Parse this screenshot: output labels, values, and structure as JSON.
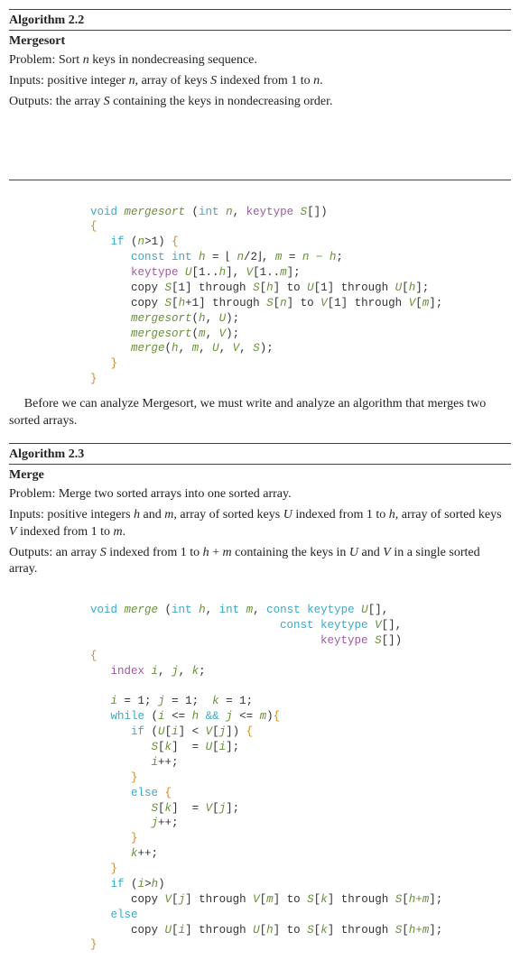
{
  "algo22": {
    "title": "Algorithm 2.2",
    "name": "Mergesort",
    "problem_label": "Problem: ",
    "problem": "Sort n keys in nondecreasing sequence.",
    "inputs_label": "Inputs: ",
    "inputs": "positive integer n, array of keys S indexed from 1 to n.",
    "outputs_label": "Outputs: ",
    "outputs": "the array S containing the keys in nondecreasing order.",
    "code": {
      "l1a": "void",
      "l1b": " mergesort ",
      "l1c": "(",
      "l1d": "int",
      "l1e": " n",
      "l1f": ", ",
      "l1g": "keytype",
      "l1h": " S",
      "l1i": "[])",
      "l2": "{",
      "l3a": "if",
      "l3b": " (",
      "l3c": "n",
      "l3d": ">1) ",
      "l3e": "{",
      "l4a": "const int",
      "l4b": " h ",
      "l4c": "= ⌊ ",
      "l4d": "n",
      "l4e": "/2⌋, ",
      "l4f": "m ",
      "l4g": "= ",
      "l4h": "n − h",
      "l4i": ";",
      "l5a": "keytype",
      "l5b": " U",
      "l5c": "[1..",
      "l5d": "h",
      "l5e": "], ",
      "l5f": "V",
      "l5g": "[1..",
      "l5h": "m",
      "l5i": "];",
      "l6a": "copy ",
      "l6b": "S",
      "l6c": "[1] through ",
      "l6d": "S",
      "l6e": "[",
      "l6f": "h",
      "l6g": "] to ",
      "l6h": "U",
      "l6i": "[1] through ",
      "l6j": "U",
      "l6k": "[",
      "l6l": "h",
      "l6m": "];",
      "l7a": "copy ",
      "l7b": "S",
      "l7c": "[",
      "l7d": "h",
      "l7e": "+1] through ",
      "l7f": "S",
      "l7g": "[",
      "l7h": "n",
      "l7i": "] to ",
      "l7j": "V",
      "l7k": "[1] through ",
      "l7l": "V",
      "l7m": "[",
      "l7n": "m",
      "l7o": "];",
      "l8a": "mergesort",
      "l8b": "(",
      "l8c": "h",
      "l8d": ", ",
      "l8e": "U",
      "l8f": ");",
      "l9a": "mergesort",
      "l9b": "(",
      "l9c": "m",
      "l9d": ", ",
      "l9e": "V",
      "l9f": ");",
      "l10a": "merge",
      "l10b": "(",
      "l10c": "h",
      "l10d": ", ",
      "l10e": "m",
      "l10f": ", ",
      "l10g": "U",
      "l10h": ", ",
      "l10i": "V",
      "l10j": ", ",
      "l10k": "S",
      "l10l": ");",
      "l11": "}",
      "l12": "}"
    }
  },
  "mid_para": "Before we can analyze Mergesort, we must write and analyze an algorithm that merges two sorted arrays.",
  "algo23": {
    "title": "Algorithm 2.3",
    "name": "Merge",
    "problem_label": "Problem: ",
    "problem": "Merge two sorted arrays into one sorted array.",
    "inputs_label": "Inputs: ",
    "inputs": "positive integers h and m, array of sorted keys U indexed from 1 to h, array of sorted keys V indexed from 1 to m.",
    "outputs_label": "Outputs: ",
    "outputs": "an array S indexed from 1 to h + m containing the keys in U and V in a single sorted array.",
    "code": {
      "l1a": "void",
      "l1b": " merge ",
      "l1c": "(",
      "l1d": "int",
      "l1e": " h",
      "l1f": ", ",
      "l1g": "int",
      "l1h": " m",
      "l1i": ", ",
      "l1j": "const keytype",
      "l1k": " U",
      "l1l": "[],",
      "l1m": "const keytype",
      "l1n": " V",
      "l1o": "[],",
      "l1p": "keytype",
      "l1q": " S",
      "l1r": "[])",
      "l2": "{",
      "l3a": "index",
      "l3b": " i",
      "l3c": ", ",
      "l3d": "j",
      "l3e": ", ",
      "l3f": "k",
      "l3g": ";",
      "l4a": "i ",
      "l4b": "= 1; ",
      "l4c": "j ",
      "l4d": "= 1;  ",
      "l4e": "k ",
      "l4f": "= 1;",
      "l5a": "while",
      "l5b": " (",
      "l5c": "i ",
      "l5d": "<= ",
      "l5e": "h ",
      "l5f": "&&",
      "l5g": " j ",
      "l5h": "<= ",
      "l5i": "m",
      "l5j": ")",
      "l5k": "{",
      "l6a": "if",
      "l6b": " (",
      "l6c": "U",
      "l6d": "[",
      "l6e": "i",
      "l6f": "] < ",
      "l6g": "V",
      "l6h": "[",
      "l6i": "j",
      "l6j": "]) ",
      "l6k": "{",
      "l7a": "S",
      "l7b": "[",
      "l7c": "k",
      "l7d": "]  = ",
      "l7e": "U",
      "l7f": "[",
      "l7g": "i",
      "l7h": "];",
      "l8a": "i",
      "l8b": "++;",
      "l9": "}",
      "l10a": "else",
      "l10b": " {",
      "l11a": "S",
      "l11b": "[",
      "l11c": "k",
      "l11d": "]  = ",
      "l11e": "V",
      "l11f": "[",
      "l11g": "j",
      "l11h": "];",
      "l12a": "j",
      "l12b": "++;",
      "l13": "}",
      "l14a": "k",
      "l14b": "++;",
      "l15": "}",
      "l16a": "if",
      "l16b": " (",
      "l16c": "i",
      "l16d": ">",
      "l16e": "h",
      "l16f": ")",
      "l17a": "copy ",
      "l17b": "V",
      "l17c": "[",
      "l17d": "j",
      "l17e": "] through ",
      "l17f": "V",
      "l17g": "[",
      "l17h": "m",
      "l17i": "] to ",
      "l17j": "S",
      "l17k": "[",
      "l17l": "k",
      "l17m": "] through ",
      "l17n": "S",
      "l17o": "[",
      "l17p": "h+m",
      "l17q": "];",
      "l18": "else",
      "l19a": "copy ",
      "l19b": "U",
      "l19c": "[",
      "l19d": "i",
      "l19e": "] through ",
      "l19f": "U",
      "l19g": "[",
      "l19h": "h",
      "l19i": "] to ",
      "l19j": "S",
      "l19k": "[",
      "l19l": "k",
      "l19m": "] through ",
      "l19n": "S",
      "l19o": "[",
      "l19p": "h+m",
      "l19q": "];",
      "l20": "}"
    }
  }
}
